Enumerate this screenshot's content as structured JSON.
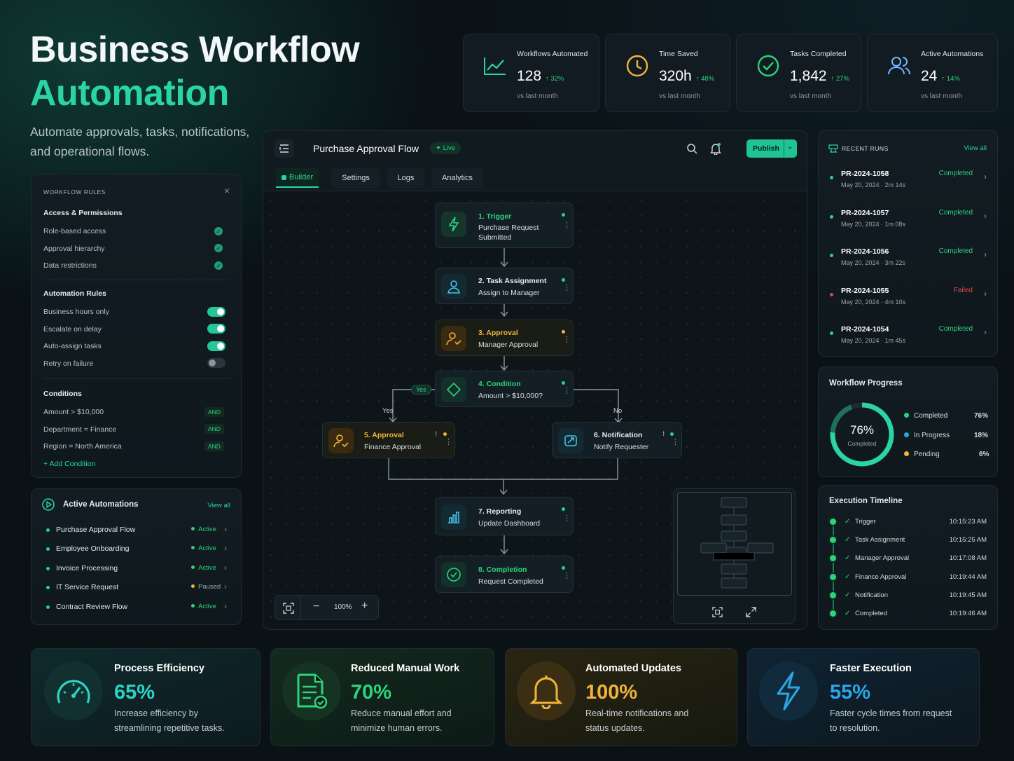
{
  "hero": {
    "title_line1": "Business Workflow",
    "title_line2": "Automation",
    "subtitle": "Automate approvals, tasks, notifications, and operational flows."
  },
  "stats": [
    {
      "label": "Workflows Automated",
      "value": "128",
      "delta": "↑ 32%",
      "sub": "vs last month",
      "icon": "trend-chart-icon"
    },
    {
      "label": "Time Saved",
      "value": "320h",
      "delta": "↑ 48%",
      "sub": "vs last month",
      "icon": "clock-icon"
    },
    {
      "label": "Tasks Completed",
      "value": "1,842",
      "delta": "↑ 27%",
      "sub": "vs last month",
      "icon": "check-circle-icon"
    },
    {
      "label": "Active Automations",
      "value": "24",
      "delta": "↑ 14%",
      "sub": "vs last month",
      "icon": "users-icon"
    }
  ],
  "rules": {
    "title": "WORKFLOW RULES",
    "close": "×",
    "access": {
      "heading": "Access & Permissions",
      "items": [
        "Role-based access",
        "Approval hierarchy",
        "Data restrictions"
      ]
    },
    "automation": {
      "heading": "Automation Rules",
      "items": [
        {
          "label": "Business hours only",
          "on": true
        },
        {
          "label": "Escalate on delay",
          "on": true
        },
        {
          "label": "Auto-assign tasks",
          "on": true
        },
        {
          "label": "Retry on failure",
          "on": false
        }
      ]
    },
    "conditions": {
      "heading": "Conditions",
      "items": [
        {
          "label": "Amount > $10,000",
          "op": "AND"
        },
        {
          "label": "Department = Finance",
          "op": "AND"
        },
        {
          "label": "Region = North America",
          "op": "AND"
        }
      ],
      "add": "+ Add Condition"
    }
  },
  "active": {
    "title": "Active Automations",
    "view_all": "View all",
    "items": [
      {
        "name": "Purchase Approval Flow",
        "status": "Active"
      },
      {
        "name": "Employee Onboarding",
        "status": "Active"
      },
      {
        "name": "Invoice Processing",
        "status": "Active"
      },
      {
        "name": "IT Service Request",
        "status": "Paused"
      },
      {
        "name": "Contract Review Flow",
        "status": "Active"
      }
    ]
  },
  "editor": {
    "title": "Purchase Approval Flow",
    "live": "✦ Live",
    "publish": "Publish",
    "tabs": [
      "Builder",
      "Settings",
      "Logs",
      "Analytics"
    ],
    "zoom": "100%",
    "nodes": [
      {
        "title": "1. Trigger",
        "desc": "Purchase Request Submitted"
      },
      {
        "title": "2. Task Assignment",
        "desc": "Assign to Manager"
      },
      {
        "title": "3. Approval",
        "desc": "Manager Approval"
      },
      {
        "title": "4. Condition",
        "desc": "Amount > $10,000?"
      },
      {
        "title": "5. Approval",
        "desc": "Finance Approval"
      },
      {
        "title": "6. Notification",
        "desc": "Notify Requester"
      },
      {
        "title": "7. Reporting",
        "desc": "Update Dashboard"
      },
      {
        "title": "8. Completion",
        "desc": "Request Completed"
      }
    ],
    "yes_badge": "Yes",
    "yes": "Yes",
    "no": "No"
  },
  "runs": {
    "title": "RECENT RUNS",
    "view_all": "View all",
    "items": [
      {
        "id": "PR-2024-1058",
        "meta": "May 20, 2024  ·  2m 14s",
        "status": "Completed"
      },
      {
        "id": "PR-2024-1057",
        "meta": "May 20, 2024  ·  1m 08s",
        "status": "Completed"
      },
      {
        "id": "PR-2024-1056",
        "meta": "May 20, 2024  ·  3m 22s",
        "status": "Completed"
      },
      {
        "id": "PR-2024-1055",
        "meta": "May 20, 2024  ·  4m 10s",
        "status": "Failed"
      },
      {
        "id": "PR-2024-1054",
        "meta": "May 20, 2024  ·  1m 45s",
        "status": "Completed"
      }
    ]
  },
  "progress": {
    "title": "Workflow Progress",
    "center_value": "76%",
    "center_label": "Completed",
    "completed_fraction": 0.76,
    "in_progress_fraction": 0.18,
    "legend": [
      {
        "label": "Completed",
        "value": "76%",
        "color": "#2bd47c"
      },
      {
        "label": "In Progress",
        "value": "18%",
        "color": "#2aa7d8"
      },
      {
        "label": "Pending",
        "value": "6%",
        "color": "#f0b43c"
      }
    ]
  },
  "timeline": {
    "title": "Execution Timeline",
    "items": [
      {
        "label": "Trigger",
        "time": "10:15:23 AM"
      },
      {
        "label": "Task Assignment",
        "time": "10:15:25 AM"
      },
      {
        "label": "Manager Approval",
        "time": "10:17:08 AM"
      },
      {
        "label": "Finance Approval",
        "time": "10:19:44 AM"
      },
      {
        "label": "Notification",
        "time": "10:19:45 AM"
      },
      {
        "label": "Completed",
        "time": "10:19:46 AM"
      }
    ]
  },
  "benefits": [
    {
      "title": "Process Efficiency",
      "value": "65%",
      "desc": "Increase efficiency by streamlining repetitive tasks.",
      "color": "#2bd4c4",
      "icon": "gauge-icon"
    },
    {
      "title": "Reduced Manual Work",
      "value": "70%",
      "desc": "Reduce manual effort and minimize human errors.",
      "color": "#2bd47c",
      "icon": "document-check-icon"
    },
    {
      "title": "Automated Updates",
      "value": "100%",
      "desc": "Real-time notifications and status updates.",
      "color": "#f0b43c",
      "icon": "bell-icon"
    },
    {
      "title": "Faster Execution",
      "value": "55%",
      "desc": "Faster cycle times from request to resolution.",
      "color": "#2aa7e8",
      "icon": "lightning-icon"
    }
  ]
}
